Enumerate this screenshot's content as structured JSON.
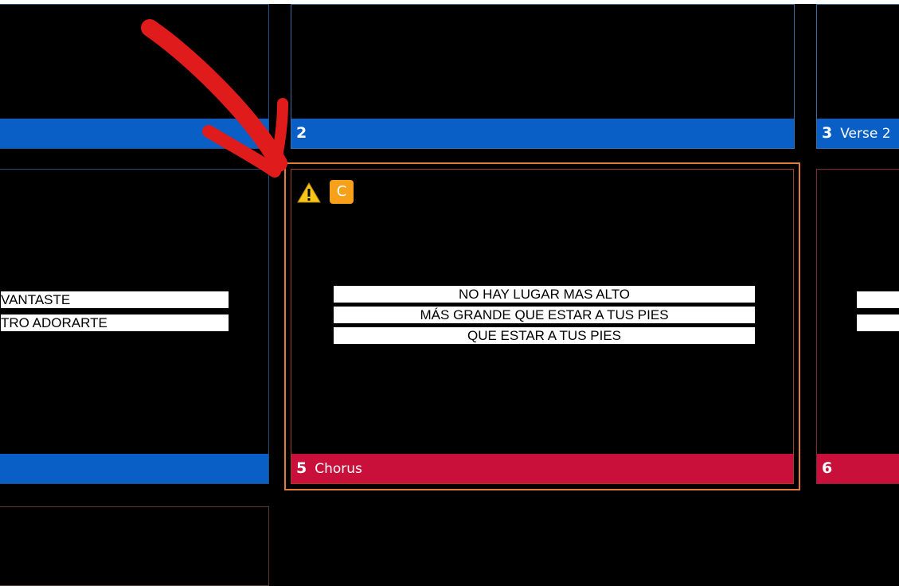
{
  "slides": {
    "slide_top_left": {},
    "slide_2": {
      "number": "2",
      "label": ""
    },
    "slide_3": {
      "number": "3",
      "label": "Verse 2"
    },
    "slide_4": {
      "lines": [
        "VANTASTE",
        "TRO ADORARTE"
      ]
    },
    "slide_5": {
      "number": "5",
      "label": "Chorus",
      "badge": "C",
      "warning_icon": "warning-icon",
      "lines": [
        "NO HAY LUGAR MAS ALTO",
        "MÁS GRANDE QUE ESTAR A TUS PIES",
        "QUE ESTAR A TUS PIES"
      ]
    },
    "slide_6": {
      "number": "6",
      "label": ""
    }
  },
  "annotation": {
    "icon": "arrow-icon",
    "color": "#e01b1b"
  },
  "colors": {
    "bar_blue": "#0a5fc7",
    "bar_red": "#c8103a",
    "selection": "#e07b3a",
    "badge": "#f7a01a"
  }
}
